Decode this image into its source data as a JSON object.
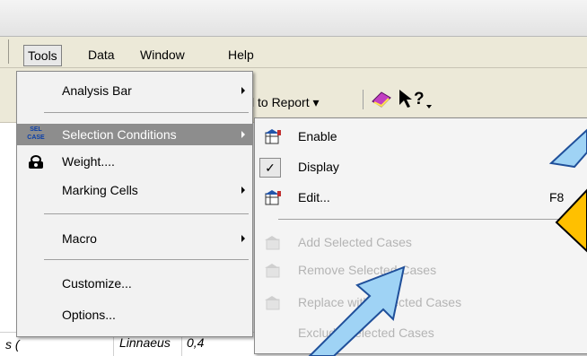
{
  "menubar": {
    "items": [
      {
        "label": "Tools",
        "open": true
      },
      {
        "label": "Data"
      },
      {
        "label": "Window"
      },
      {
        "label": "Help"
      }
    ]
  },
  "toolbar": {
    "add_to_report": "l to Report ▾"
  },
  "tools_menu": {
    "items": [
      {
        "label": "Analysis Bar",
        "submenu": true
      },
      {
        "label": "Selection Conditions",
        "submenu": true,
        "highlighted": true,
        "icon": "sel-case-icon",
        "icon_text_top": "SEL",
        "icon_text_bottom": "CASE"
      },
      {
        "label": "Weight....",
        "icon": "weight-icon"
      },
      {
        "label": "Marking Cells",
        "submenu": true
      },
      {
        "label": "Macro",
        "submenu": true
      },
      {
        "label": "Customize..."
      },
      {
        "label": "Options..."
      }
    ]
  },
  "selection_submenu": {
    "items": [
      {
        "label": "Enable",
        "icon": "enable-icon"
      },
      {
        "label": "Display",
        "checked": true,
        "check_glyph": "✓"
      },
      {
        "label": "Edit...",
        "shortcut": "F8",
        "icon": "edit-icon"
      },
      {
        "label": "Add Selected Cases",
        "disabled": true
      },
      {
        "label": "Remove Selected Cases",
        "disabled": true
      },
      {
        "label": "Replace with Selected Cases",
        "disabled": true
      },
      {
        "label": "Exclude Selected Cases",
        "disabled": true
      }
    ]
  },
  "sheet": {
    "cell_left": "s (",
    "cell_linnaeus": "Linnaeus",
    "cell_value": "0,4"
  },
  "colors": {
    "menubar_bg": "#ece9d8",
    "highlight": "#8d8d8d",
    "arrow_fill": "#9fd3f5",
    "arrow_stroke": "#1f4f9a",
    "diamond_fill": "#ffc000"
  }
}
